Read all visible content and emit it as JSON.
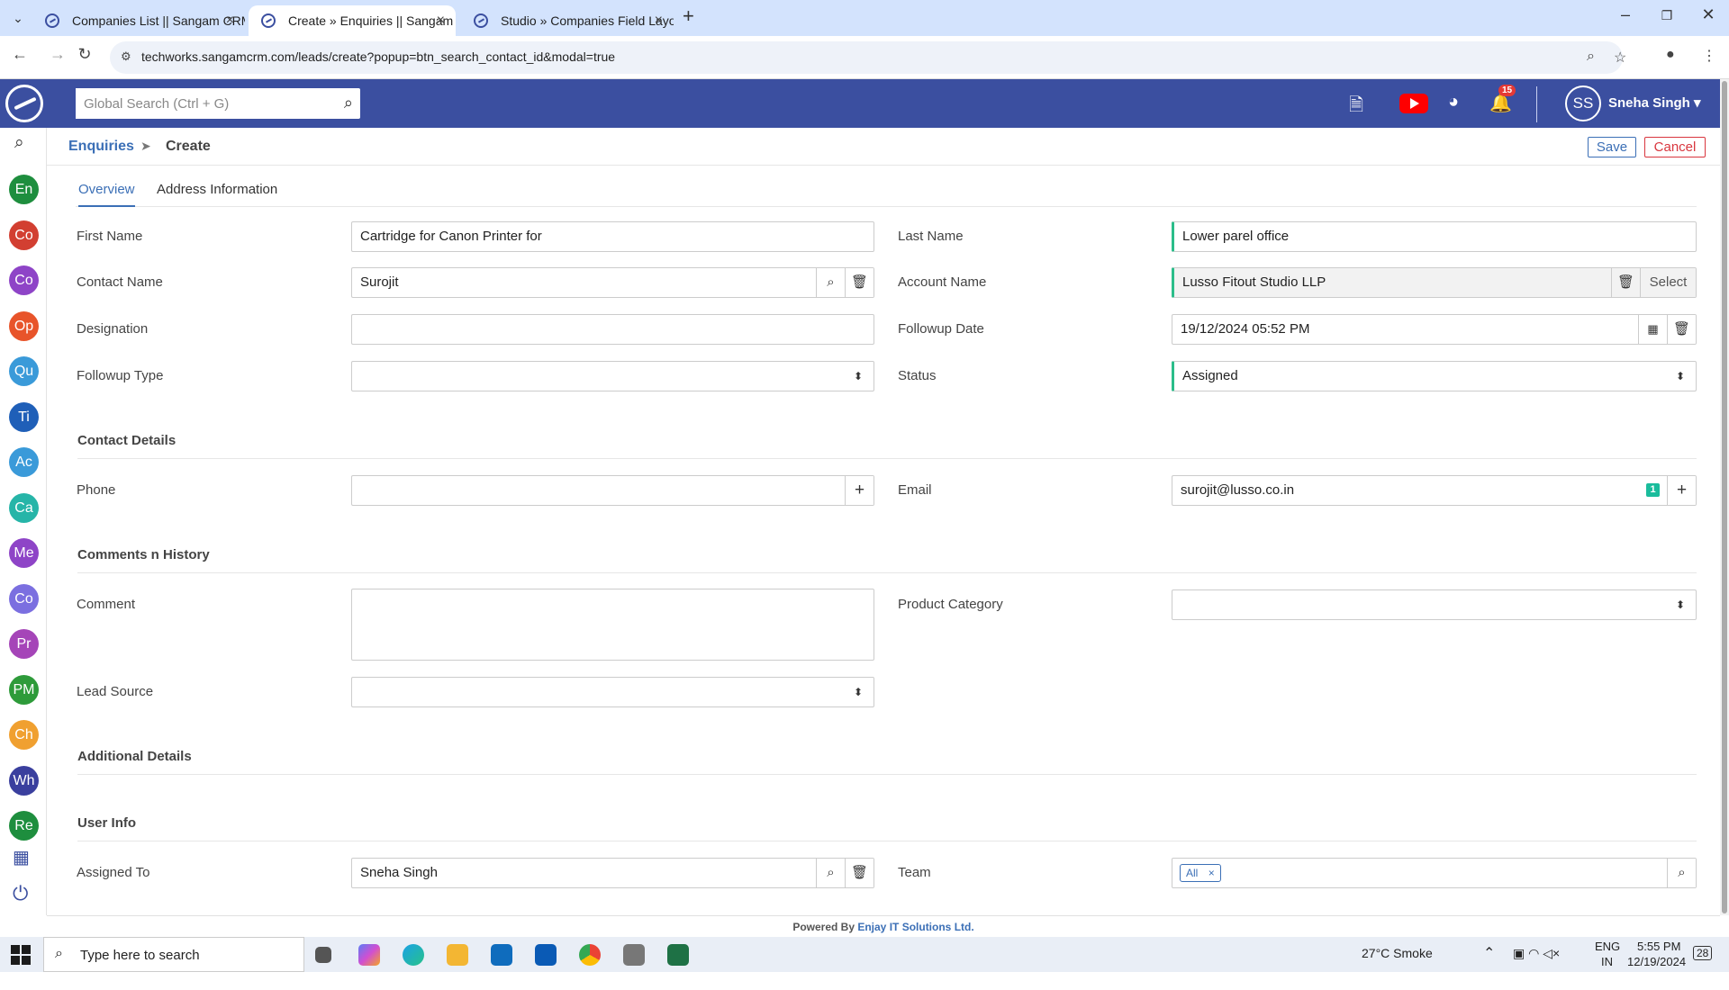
{
  "browser": {
    "tabs": [
      {
        "title": "Companies List || Sangam CRM"
      },
      {
        "title": "Create » Enquiries || Sangam CR"
      },
      {
        "title": "Studio » Companies Field Layou"
      }
    ],
    "url": "techworks.sangamcrm.com/leads/create?popup=btn_search_contact_id&modal=true"
  },
  "header": {
    "search_placeholder": "Global Search (Ctrl + G)",
    "notification_count": "15",
    "avatar_initials": "SS",
    "user_name": "Sneha Singh ▾",
    "brand_color": "#3b4fa0"
  },
  "sidebar": {
    "items": [
      {
        "label": "En",
        "color": "#1e8e3e"
      },
      {
        "label": "Co",
        "color": "#d23f31"
      },
      {
        "label": "Co",
        "color": "#8e44c7"
      },
      {
        "label": "Op",
        "color": "#e8542a"
      },
      {
        "label": "Qu",
        "color": "#3a9ad9"
      },
      {
        "label": "Ti",
        "color": "#1f5fb8"
      },
      {
        "label": "Ac",
        "color": "#3a9ad9"
      },
      {
        "label": "Ca",
        "color": "#26b5a8"
      },
      {
        "label": "Me",
        "color": "#8e44c7"
      },
      {
        "label": "Co",
        "color": "#7b6fe0"
      },
      {
        "label": "Pr",
        "color": "#a545b8"
      },
      {
        "label": "PM",
        "color": "#2e9b3a"
      },
      {
        "label": "Ch",
        "color": "#f0a030"
      },
      {
        "label": "Wh",
        "color": "#3a3f9e"
      },
      {
        "label": "Re",
        "color": "#1e8e3e"
      }
    ]
  },
  "breadcrumb": {
    "module": "Enquiries",
    "separator": "➤",
    "current": "Create"
  },
  "actions": {
    "save": "Save",
    "cancel": "Cancel"
  },
  "form_tabs": [
    "Overview",
    "Address Information"
  ],
  "fields": {
    "first_name": {
      "label": "First Name",
      "value": "Cartridge for Canon Printer for"
    },
    "last_name": {
      "label": "Last Name",
      "value": "Lower parel office"
    },
    "contact_name": {
      "label": "Contact Name",
      "value": "Surojit"
    },
    "account_name": {
      "label": "Account Name",
      "value": "Lusso Fitout Studio LLP",
      "select_label": "Select"
    },
    "designation": {
      "label": "Designation",
      "value": ""
    },
    "followup_date": {
      "label": "Followup Date",
      "value": "19/12/2024 05:52 PM"
    },
    "followup_type": {
      "label": "Followup Type",
      "value": ""
    },
    "status": {
      "label": "Status",
      "value": "Assigned"
    },
    "phone": {
      "label": "Phone",
      "value": ""
    },
    "email": {
      "label": "Email",
      "value": "surojit@lusso.co.in",
      "count": "1"
    },
    "comment": {
      "label": "Comment",
      "value": ""
    },
    "product_category": {
      "label": "Product Category",
      "value": ""
    },
    "lead_source": {
      "label": "Lead Source",
      "value": ""
    },
    "assigned_to": {
      "label": "Assigned To",
      "value": "Sneha Singh"
    },
    "team": {
      "label": "Team",
      "chip": "All",
      "chip_remove": "×"
    }
  },
  "sections": {
    "contact_details": "Contact Details",
    "comments_history": "Comments n History",
    "additional_details": "Additional Details",
    "user_info": "User Info"
  },
  "footer": {
    "prefix": "Powered By ",
    "company": "Enjay IT Solutions Ltd."
  },
  "taskbar": {
    "search_placeholder": "Type here to search",
    "weather": "27°C  Smoke",
    "language": "ENG",
    "region": "IN",
    "time": "5:55 PM",
    "date": "12/19/2024",
    "notification_count": "28"
  }
}
